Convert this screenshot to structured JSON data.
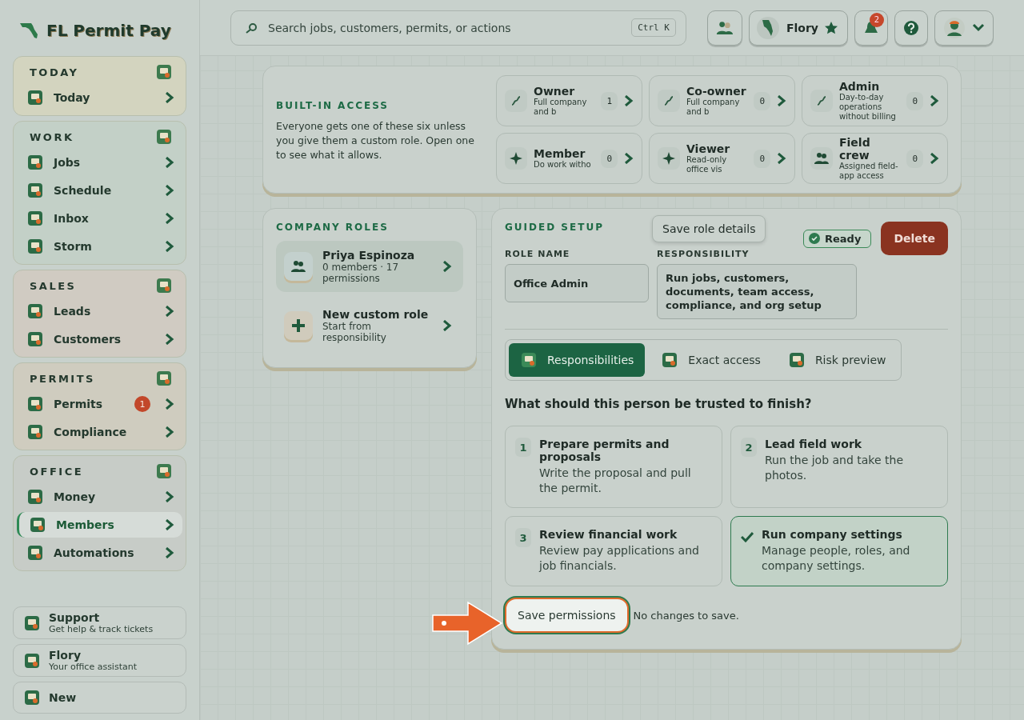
{
  "brand": {
    "name": "FL Permit Pay"
  },
  "sidebar": {
    "groups": [
      {
        "title": "TODAY",
        "color": "#d3d4bf",
        "items": [
          {
            "label": "Today",
            "selected": false
          }
        ]
      },
      {
        "title": "WORK",
        "color": "#c3d0c7",
        "items": [
          {
            "label": "Jobs",
            "selected": false
          },
          {
            "label": "Schedule",
            "selected": false
          },
          {
            "label": "Inbox",
            "selected": false
          },
          {
            "label": "Storm",
            "selected": false
          }
        ]
      },
      {
        "title": "SALES",
        "color": "#d0cbc2",
        "items": [
          {
            "label": "Leads",
            "selected": false
          },
          {
            "label": "Customers",
            "selected": false
          }
        ]
      },
      {
        "title": "PERMITS",
        "color": "#cfccbf",
        "items": [
          {
            "label": "Permits",
            "selected": false,
            "badge": "1"
          },
          {
            "label": "Compliance",
            "selected": false
          }
        ]
      },
      {
        "title": "OFFICE",
        "color": "#c7ccc7",
        "items": [
          {
            "label": "Money",
            "selected": false
          },
          {
            "label": "Members",
            "selected": true
          },
          {
            "label": "Automations",
            "selected": false
          }
        ]
      }
    ],
    "footer": [
      {
        "title": "Support",
        "subtitle": "Get help & track tickets"
      },
      {
        "title": "Flory",
        "subtitle": "Your office assistant"
      },
      {
        "title": "New"
      }
    ]
  },
  "topbar": {
    "search": {
      "placeholder": "Search jobs, customers, permits, or actions",
      "shortcut": "Ctrl K"
    },
    "assistant": "Flory",
    "notifications": "2"
  },
  "builtin_access": {
    "title": "BUILT-IN ACCESS",
    "description": "Everyone gets one of these six unless you give them a custom role. Open one to see what it allows.",
    "roles": [
      {
        "name": "Owner",
        "count": "1",
        "description": "Full company and b"
      },
      {
        "name": "Co-owner",
        "count": "0",
        "description": "Full company and b"
      },
      {
        "name": "Admin",
        "count": "0",
        "description": "Day-to-day operations without billing"
      },
      {
        "name": "Member",
        "count": "0",
        "description": "Do work witho"
      },
      {
        "name": "Viewer",
        "count": "0",
        "description": "Read-only office vis"
      },
      {
        "name": "Field crew",
        "count": "0",
        "description": "Assigned field-app access"
      }
    ]
  },
  "company_roles": {
    "title": "COMPANY ROLES",
    "roles": [
      {
        "kind": "role",
        "name": "Priya Espinoza",
        "detail": "0 members · 17 permissions",
        "selected": true
      },
      {
        "kind": "new",
        "name": "New custom role",
        "detail": "Start from responsibility",
        "selected": false
      }
    ]
  },
  "guided_setup": {
    "title": "GUIDED SETUP",
    "status": "Ready",
    "delete": "Delete",
    "tooltip": "Save role details",
    "fields": [
      {
        "label": "ROLE NAME",
        "value": "Office Admin"
      },
      {
        "label": "RESPONSIBILITY",
        "value": "Run jobs, customers, documents, team access, compliance, and org setup"
      }
    ],
    "tabs": [
      {
        "label": "Responsibilities",
        "selected": true
      },
      {
        "label": "Exact access",
        "selected": false
      },
      {
        "label": "Risk preview",
        "selected": false
      }
    ],
    "question": "What should this person be trusted to finish?",
    "responsibilities": [
      {
        "number": "1",
        "title": "Prepare permits and proposals",
        "description": "Write the proposal and pull the permit.",
        "checked": false
      },
      {
        "number": "2",
        "title": "Lead field work",
        "description": "Run the job and take the photos.",
        "checked": false
      },
      {
        "number": "3",
        "title": "Review financial work",
        "description": "Review pay applications and job financials.",
        "checked": false
      },
      {
        "title": "Run company settings",
        "description": "Manage people, roles, and company settings.",
        "checked": true
      }
    ],
    "save": "Save permissions",
    "save_status": "No changes to save."
  }
}
